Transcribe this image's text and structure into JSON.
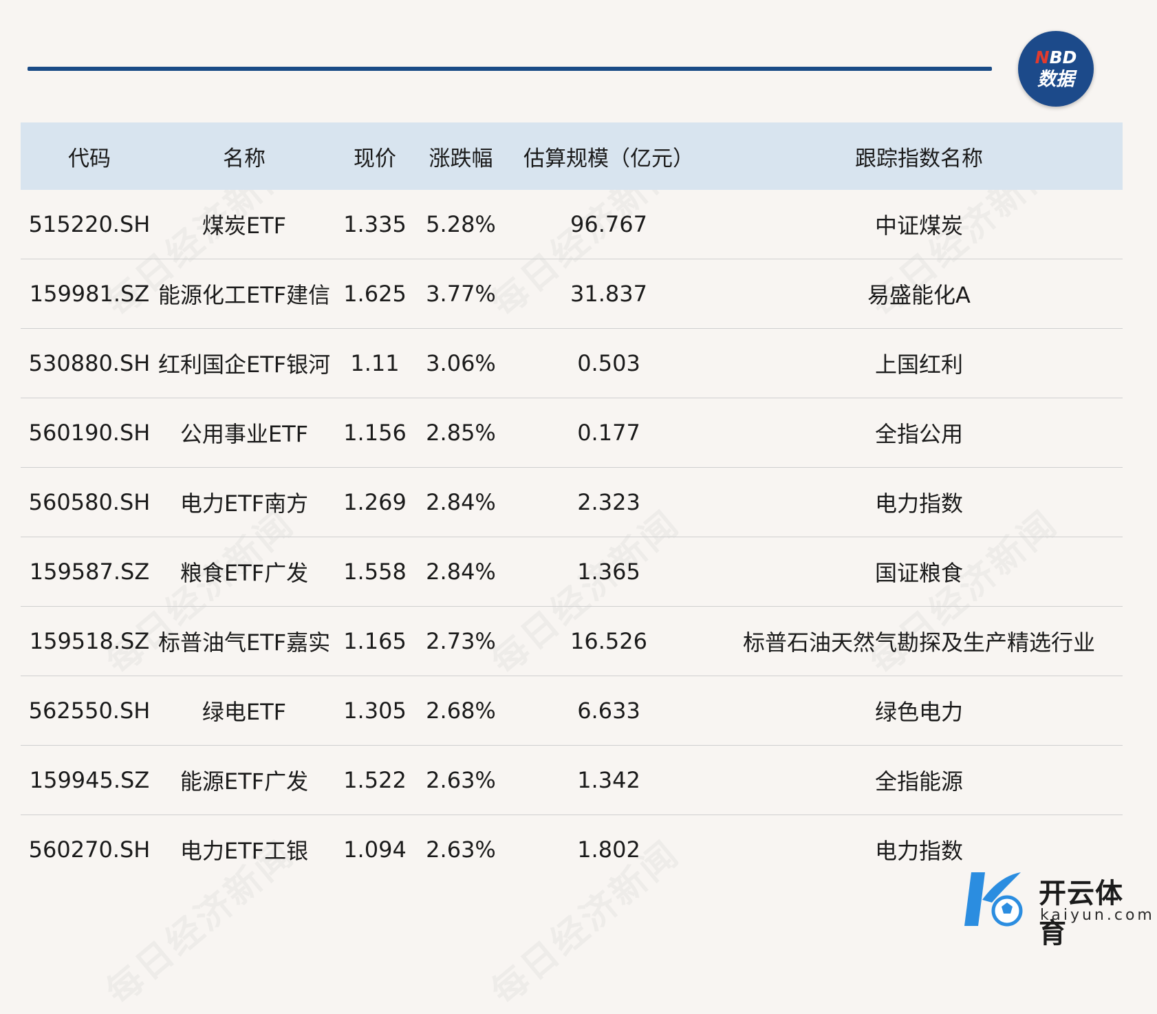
{
  "logo": {
    "brand_letters": "NBD",
    "brand_letter_first": "N",
    "brand_letters_rest": "BD",
    "brand_sub": "数据"
  },
  "watermark_text": "每日经济新闻",
  "table": {
    "headers": [
      "代码",
      "名称",
      "现价",
      "涨跌幅",
      "估算规模（亿元）",
      "跟踪指数名称"
    ],
    "rows": [
      [
        "515220.SH",
        "煤炭ETF",
        "1.335",
        "5.28%",
        "96.767",
        "中证煤炭"
      ],
      [
        "159981.SZ",
        "能源化工ETF建信",
        "1.625",
        "3.77%",
        "31.837",
        "易盛能化A"
      ],
      [
        "530880.SH",
        "红利国企ETF银河",
        "1.11",
        "3.06%",
        "0.503",
        "上国红利"
      ],
      [
        "560190.SH",
        "公用事业ETF",
        "1.156",
        "2.85%",
        "0.177",
        "全指公用"
      ],
      [
        "560580.SH",
        "电力ETF南方",
        "1.269",
        "2.84%",
        "2.323",
        "电力指数"
      ],
      [
        "159587.SZ",
        "粮食ETF广发",
        "1.558",
        "2.84%",
        "1.365",
        "国证粮食"
      ],
      [
        "159518.SZ",
        "标普油气ETF嘉实",
        "1.165",
        "2.73%",
        "16.526",
        "标普石油天然气勘探及生产精选行业"
      ],
      [
        "562550.SH",
        "绿电ETF",
        "1.305",
        "2.68%",
        "6.633",
        "绿色电力"
      ],
      [
        "159945.SZ",
        "能源ETF广发",
        "1.522",
        "2.63%",
        "1.342",
        "全指能源"
      ],
      [
        "560270.SH",
        "电力ETF工银",
        "1.094",
        "2.63%",
        "1.802",
        "电力指数"
      ]
    ]
  },
  "footer_logo": {
    "name": "开云体育",
    "url": "kaiyun.com"
  },
  "colors": {
    "rule": "#1a4b86",
    "header_bg": "#d8e4ef",
    "page_bg": "#f8f5f2",
    "logo_bg": "#1c4a8a",
    "logo_accent": "#e23b2e",
    "kaiyun_blue": "#2b8de0"
  }
}
